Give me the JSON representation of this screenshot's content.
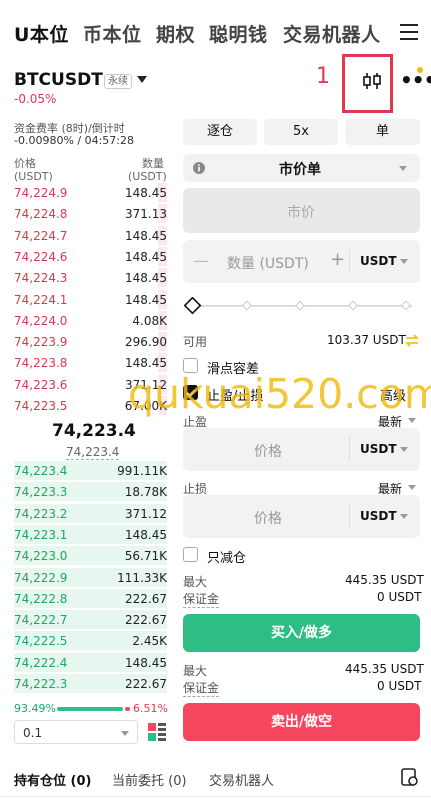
{
  "tabs": [
    "U本位",
    "币本位",
    "期权",
    "聪明钱",
    "交易机器人"
  ],
  "symbol": {
    "name": "BTCUSDT",
    "type": "永续",
    "change": "-0.05%"
  },
  "annotation_mark": "1",
  "funding": {
    "label": "资金费率 (8时)/倒计时",
    "value": "-0.00980% / 04:57:28"
  },
  "orderbook": {
    "price_header": "价格",
    "price_unit": "(USDT)",
    "qty_header": "数量",
    "qty_unit": "(USDT)",
    "asks": [
      {
        "price": "74,224.9",
        "qty": "148.45",
        "depth": 0.06
      },
      {
        "price": "74,224.8",
        "qty": "371.13",
        "depth": 0.06
      },
      {
        "price": "74,224.7",
        "qty": "148.45",
        "depth": 0.06
      },
      {
        "price": "74,224.6",
        "qty": "148.45",
        "depth": 0.06
      },
      {
        "price": "74,224.3",
        "qty": "148.45",
        "depth": 0.06
      },
      {
        "price": "74,224.1",
        "qty": "148.45",
        "depth": 0.06
      },
      {
        "price": "74,224.0",
        "qty": "4.08K",
        "depth": 0.06
      },
      {
        "price": "74,223.9",
        "qty": "296.90",
        "depth": 0.06
      },
      {
        "price": "74,223.8",
        "qty": "148.45",
        "depth": 0.06
      },
      {
        "price": "74,223.6",
        "qty": "371.12",
        "depth": 0.06
      },
      {
        "price": "74,223.5",
        "qty": "67.00K",
        "depth": 0.06
      }
    ],
    "last_price": "74,223.4",
    "mark_price": "74,223.4",
    "bids": [
      {
        "price": "74,223.4",
        "qty": "991.11K",
        "depth": 1.0
      },
      {
        "price": "74,223.3",
        "qty": "18.78K",
        "depth": 1.0
      },
      {
        "price": "74,223.2",
        "qty": "371.12",
        "depth": 1.0
      },
      {
        "price": "74,223.1",
        "qty": "148.45",
        "depth": 1.0
      },
      {
        "price": "74,223.0",
        "qty": "56.71K",
        "depth": 1.0
      },
      {
        "price": "74,222.9",
        "qty": "111.33K",
        "depth": 1.0
      },
      {
        "price": "74,222.8",
        "qty": "222.67",
        "depth": 1.0
      },
      {
        "price": "74,222.7",
        "qty": "222.67",
        "depth": 1.0
      },
      {
        "price": "74,222.5",
        "qty": "2.45K",
        "depth": 1.0
      },
      {
        "price": "74,222.4",
        "qty": "148.45",
        "depth": 1.0
      },
      {
        "price": "74,222.3",
        "qty": "222.67",
        "depth": 1.0
      }
    ],
    "buy_ratio": "93.49%",
    "sell_ratio": "6.51%",
    "buy_fraction": 0.9349,
    "depth_step": "0.1"
  },
  "order_form": {
    "margin_mode": "逐仓",
    "leverage": "5x",
    "position_mode": "单",
    "order_type": "市价单",
    "price_placeholder": "市价",
    "qty_placeholder": "数量 (USDT)",
    "qty_unit": "USDT",
    "minus": "—",
    "plus": "+",
    "available_label": "可用",
    "available_value": "103.37 USDT",
    "slippage_label": "滑点容差",
    "tpsl_label": "止盈/止损",
    "advanced_label": "高级",
    "tp_label": "止盈",
    "tp_mode": "最新",
    "tp_placeholder": "价格",
    "tp_unit": "USDT",
    "sl_label": "止损",
    "sl_mode": "最新",
    "sl_placeholder": "价格",
    "sl_unit": "USDT",
    "reduce_only_label": "只减仓",
    "max_label": "最大",
    "max_value": "445.35 USDT",
    "margin_label": "保证金",
    "margin_value": "0 USDT",
    "buy_button": "买入/做多",
    "max_label2": "最大",
    "max_value2": "445.35 USDT",
    "margin_label2": "保证金",
    "margin_value2": "0 USDT",
    "sell_button": "卖出/做空"
  },
  "bottom_tabs": [
    "持有仓位 (0)",
    "当前委托 (0)",
    "交易机器人"
  ],
  "watermark": "qukuai520.com",
  "colors": {
    "buy": "#2ebd85",
    "sell": "#f6465d",
    "accent": "#f0b90b",
    "highlight": "#e0384f"
  }
}
